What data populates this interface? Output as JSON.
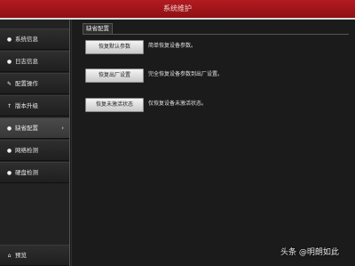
{
  "window": {
    "title": "系统维护"
  },
  "sidebar": {
    "items": [
      {
        "label": "系统信息",
        "icon": "●"
      },
      {
        "label": "日志信息",
        "icon": "●"
      },
      {
        "label": "配置操作",
        "icon": "✎"
      },
      {
        "label": "版本升级",
        "icon": "↑"
      },
      {
        "label": "缺省配置",
        "icon": "●"
      },
      {
        "label": "网络检测",
        "icon": "●"
      },
      {
        "label": "硬盘检测",
        "icon": "●"
      }
    ],
    "active_arrow": "›",
    "preview": {
      "label": "预览",
      "icon": "⌂"
    }
  },
  "main": {
    "tab_label": "缺省配置",
    "actions": [
      {
        "button": "恢复默认参数",
        "description": "简单恢复设备参数。"
      },
      {
        "button": "恢复出厂设置",
        "description": "完全恢复设备参数到出厂设置。"
      },
      {
        "button": "恢复未激活状态",
        "description": "仅恢复设备未激活状态。"
      }
    ]
  },
  "watermark": "头条 @明朗如此"
}
